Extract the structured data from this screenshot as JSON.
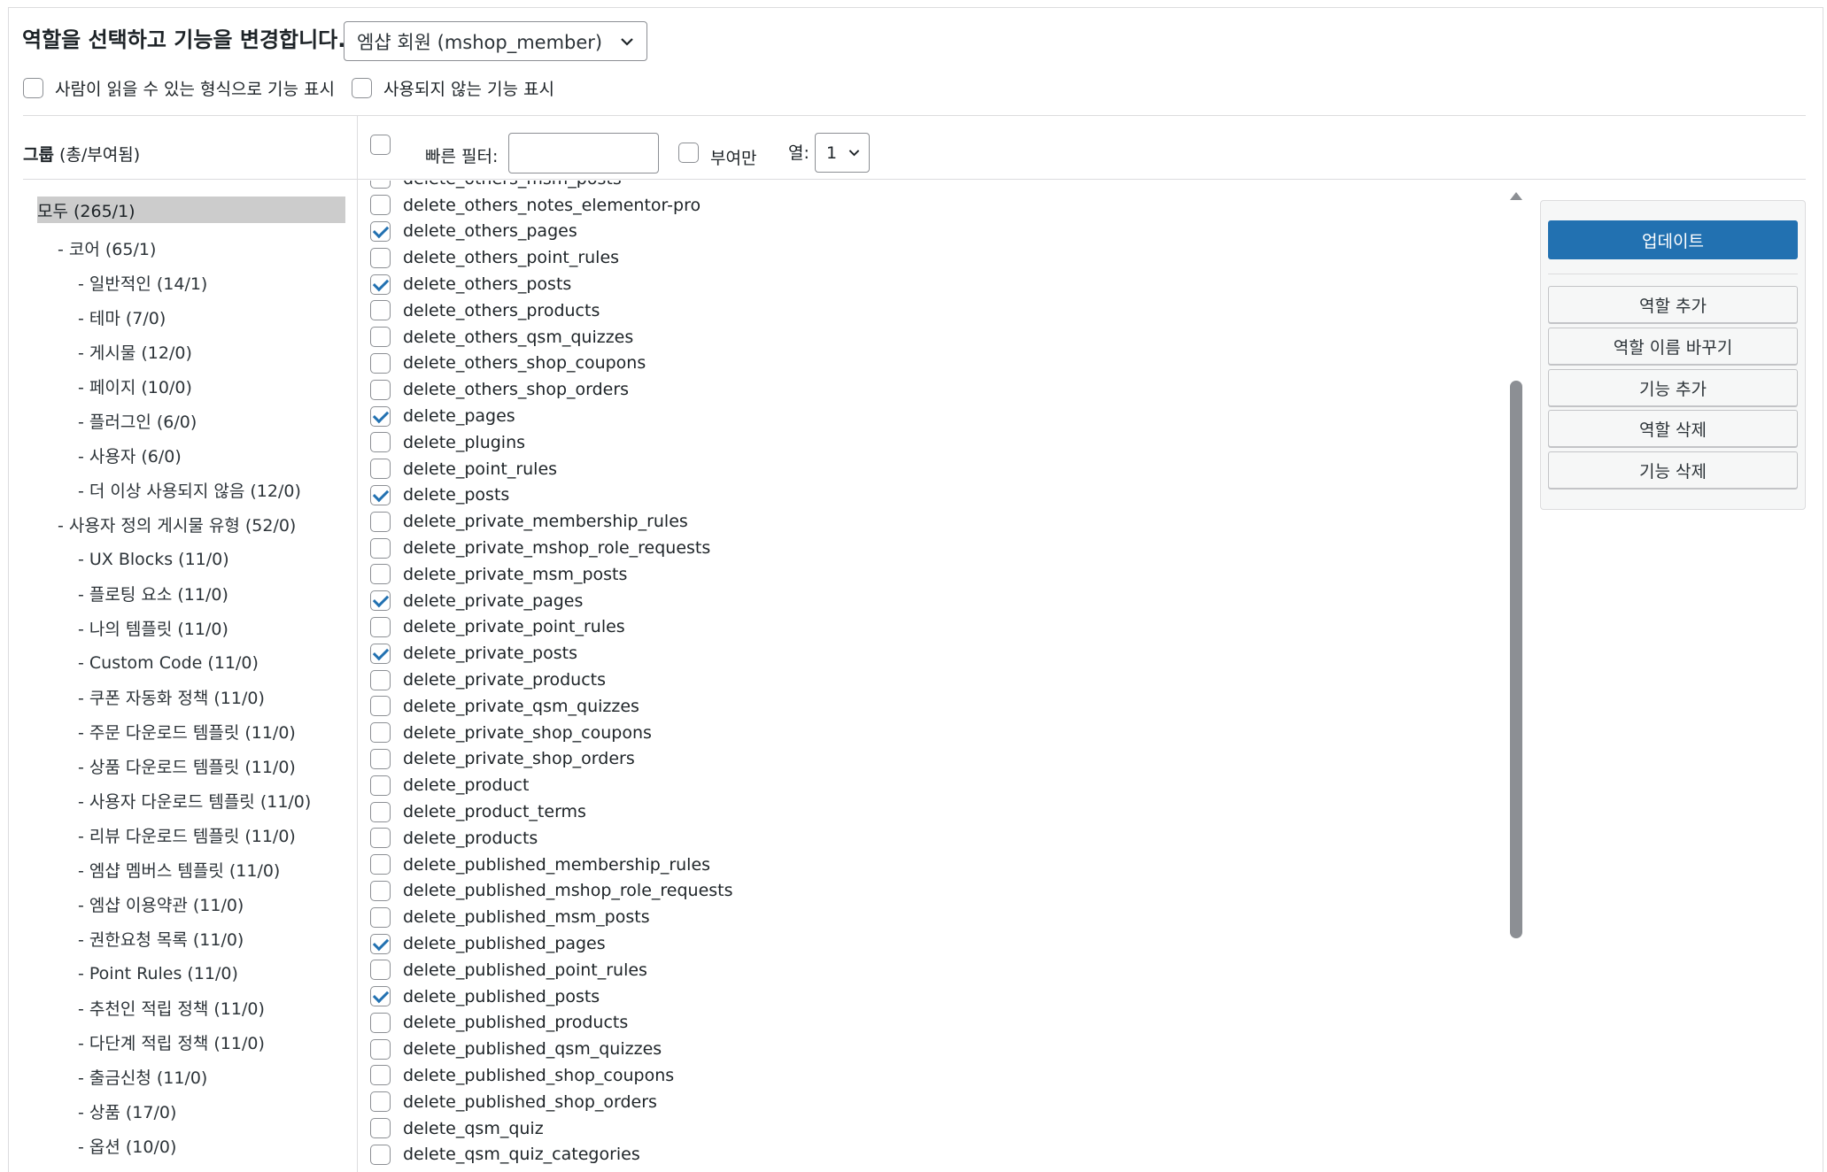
{
  "header": {
    "title": "역할을 선택하고 기능을 변경합니다.",
    "role_select_value": "엠샵 회원 (mshop_member)",
    "option_readable": "사람이 읽을 수 있는 형식으로 기능 표시",
    "option_deprecated": "사용되지 않는 기능 표시"
  },
  "groups_header": {
    "label": "그룹",
    "suffix": "(총/부여됨)"
  },
  "groups": [
    {
      "label": "모두 (265/1)"
    },
    {
      "label": "- 코어 (65/1)"
    },
    {
      "label": "- 일반적인 (14/1)"
    },
    {
      "label": "- 테마 (7/0)"
    },
    {
      "label": "- 게시물 (12/0)"
    },
    {
      "label": "- 페이지 (10/0)"
    },
    {
      "label": "- 플러그인 (6/0)"
    },
    {
      "label": "- 사용자 (6/0)"
    },
    {
      "label": "- 더 이상 사용되지 않음 (12/0)"
    },
    {
      "label": "- 사용자 정의 게시물 유형 (52/0)"
    },
    {
      "label": "- UX Blocks (11/0)"
    },
    {
      "label": "- 플로팅 요소 (11/0)"
    },
    {
      "label": "- 나의 템플릿 (11/0)"
    },
    {
      "label": "- Custom Code (11/0)"
    },
    {
      "label": "- 쿠폰 자동화 정책 (11/0)"
    },
    {
      "label": "- 주문 다운로드 템플릿 (11/0)"
    },
    {
      "label": "- 상품 다운로드 템플릿 (11/0)"
    },
    {
      "label": "- 사용자 다운로드 템플릿 (11/0)"
    },
    {
      "label": "- 리뷰 다운로드 템플릿 (11/0)"
    },
    {
      "label": "- 엠샵 멤버스 템플릿 (11/0)"
    },
    {
      "label": "- 엠샵 이용약관 (11/0)"
    },
    {
      "label": "- 권한요청 목록 (11/0)"
    },
    {
      "label": "- Point Rules (11/0)"
    },
    {
      "label": "- 추천인 적립 정책 (11/0)"
    },
    {
      "label": "- 다단계 적립 정책 (11/0)"
    },
    {
      "label": "- 출금신청 (11/0)"
    },
    {
      "label": "- 상품 (17/0)"
    },
    {
      "label": "- 옵션 (10/0)"
    }
  ],
  "filter_bar": {
    "quick_filter_label": "빠른 필터:",
    "quick_filter_value": "",
    "granted_only_label": "부여만",
    "columns_label": "열:",
    "columns_value": "1"
  },
  "capabilities": [
    {
      "name": "delete_others_msm_posts",
      "checked": false
    },
    {
      "name": "delete_others_notes_elementor-pro",
      "checked": false
    },
    {
      "name": "delete_others_pages",
      "checked": true
    },
    {
      "name": "delete_others_point_rules",
      "checked": false
    },
    {
      "name": "delete_others_posts",
      "checked": true
    },
    {
      "name": "delete_others_products",
      "checked": false
    },
    {
      "name": "delete_others_qsm_quizzes",
      "checked": false
    },
    {
      "name": "delete_others_shop_coupons",
      "checked": false
    },
    {
      "name": "delete_others_shop_orders",
      "checked": false
    },
    {
      "name": "delete_pages",
      "checked": true
    },
    {
      "name": "delete_plugins",
      "checked": false
    },
    {
      "name": "delete_point_rules",
      "checked": false
    },
    {
      "name": "delete_posts",
      "checked": true
    },
    {
      "name": "delete_private_membership_rules",
      "checked": false
    },
    {
      "name": "delete_private_mshop_role_requests",
      "checked": false
    },
    {
      "name": "delete_private_msm_posts",
      "checked": false
    },
    {
      "name": "delete_private_pages",
      "checked": true
    },
    {
      "name": "delete_private_point_rules",
      "checked": false
    },
    {
      "name": "delete_private_posts",
      "checked": true
    },
    {
      "name": "delete_private_products",
      "checked": false
    },
    {
      "name": "delete_private_qsm_quizzes",
      "checked": false
    },
    {
      "name": "delete_private_shop_coupons",
      "checked": false
    },
    {
      "name": "delete_private_shop_orders",
      "checked": false
    },
    {
      "name": "delete_product",
      "checked": false
    },
    {
      "name": "delete_product_terms",
      "checked": false
    },
    {
      "name": "delete_products",
      "checked": false
    },
    {
      "name": "delete_published_membership_rules",
      "checked": false
    },
    {
      "name": "delete_published_mshop_role_requests",
      "checked": false
    },
    {
      "name": "delete_published_msm_posts",
      "checked": false
    },
    {
      "name": "delete_published_pages",
      "checked": true
    },
    {
      "name": "delete_published_point_rules",
      "checked": false
    },
    {
      "name": "delete_published_posts",
      "checked": true
    },
    {
      "name": "delete_published_products",
      "checked": false
    },
    {
      "name": "delete_published_qsm_quizzes",
      "checked": false
    },
    {
      "name": "delete_published_shop_coupons",
      "checked": false
    },
    {
      "name": "delete_published_shop_orders",
      "checked": false
    },
    {
      "name": "delete_qsm_quiz",
      "checked": false
    },
    {
      "name": "delete_qsm_quiz_categories",
      "checked": false
    }
  ],
  "actions": {
    "update": "업데이트",
    "add_role": "역할 추가",
    "rename_role": "역할 이름 바꾸기",
    "add_capability": "기능 추가",
    "delete_role": "역할 삭제",
    "delete_capability": "기능 삭제"
  },
  "colors": {
    "primary": "#2271b1",
    "selected_group_bg": "#cccccc",
    "border": "#dcdcde"
  }
}
